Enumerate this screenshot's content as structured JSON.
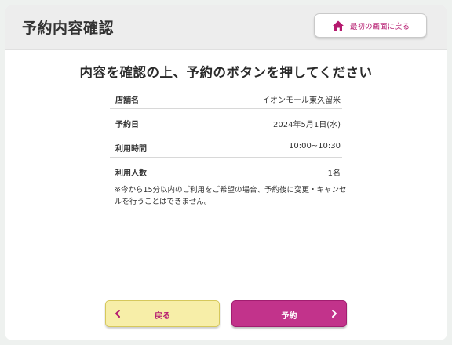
{
  "header": {
    "title": "予約内容確認",
    "home_button_label": "最初の画面に戻る"
  },
  "instruction": "内容を確認の上、予約のボタンを押してください",
  "details": [
    {
      "label": "店舗名",
      "value": "イオンモール東久留米"
    },
    {
      "label": "予約日",
      "value": "2024年5月1日(水)"
    },
    {
      "label": "利用時間",
      "value": "10:00~10:30"
    },
    {
      "label": "利用人数",
      "value": "1名"
    }
  ],
  "note": "※今から15分以内のご利用をご希望の場合、予約後に変更・キャンセルを行うことはできません。",
  "buttons": {
    "back_label": "戻る",
    "reserve_label": "予約"
  },
  "colors": {
    "accent": "#b5196e",
    "reserve_bg": "#c2338b",
    "back_bg": "#f7eea8"
  },
  "icons": {
    "home": "home-icon",
    "back": "chevron-left-icon",
    "next": "chevron-right-icon"
  }
}
